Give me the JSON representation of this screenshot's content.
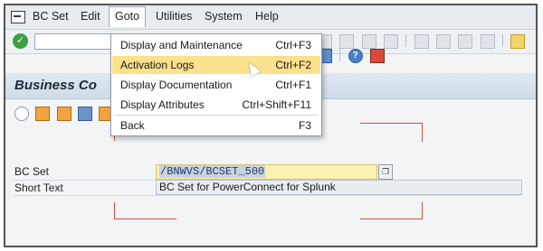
{
  "menubar": {
    "items": [
      {
        "label": "BC Set"
      },
      {
        "label": "Edit"
      },
      {
        "label": "Goto"
      },
      {
        "label": "Utilities"
      },
      {
        "label": "System"
      },
      {
        "label": "Help"
      }
    ]
  },
  "title": "Business Co",
  "dropdown": {
    "items": [
      {
        "label": "Display and Maintenance",
        "shortcut": "Ctrl+F3"
      },
      {
        "label": "Activation Logs",
        "shortcut": "Ctrl+F2"
      },
      {
        "label": "Display Documentation",
        "shortcut": "Ctrl+F1"
      },
      {
        "label": "Display Attributes",
        "shortcut": "Ctrl+Shift+F11"
      },
      {
        "label": "Back",
        "shortcut": "F3"
      }
    ]
  },
  "form": {
    "bcset_label": "BC Set",
    "bcset_value": "/BNWVS/BCSET_500",
    "short_text_label": "Short Text",
    "short_text_value": "BC Set for PowerConnect for Splunk"
  },
  "colors": {
    "highlight": "#fbe08d",
    "bracket": "#e04a3c",
    "input_highlight": "#fbf1b0"
  }
}
